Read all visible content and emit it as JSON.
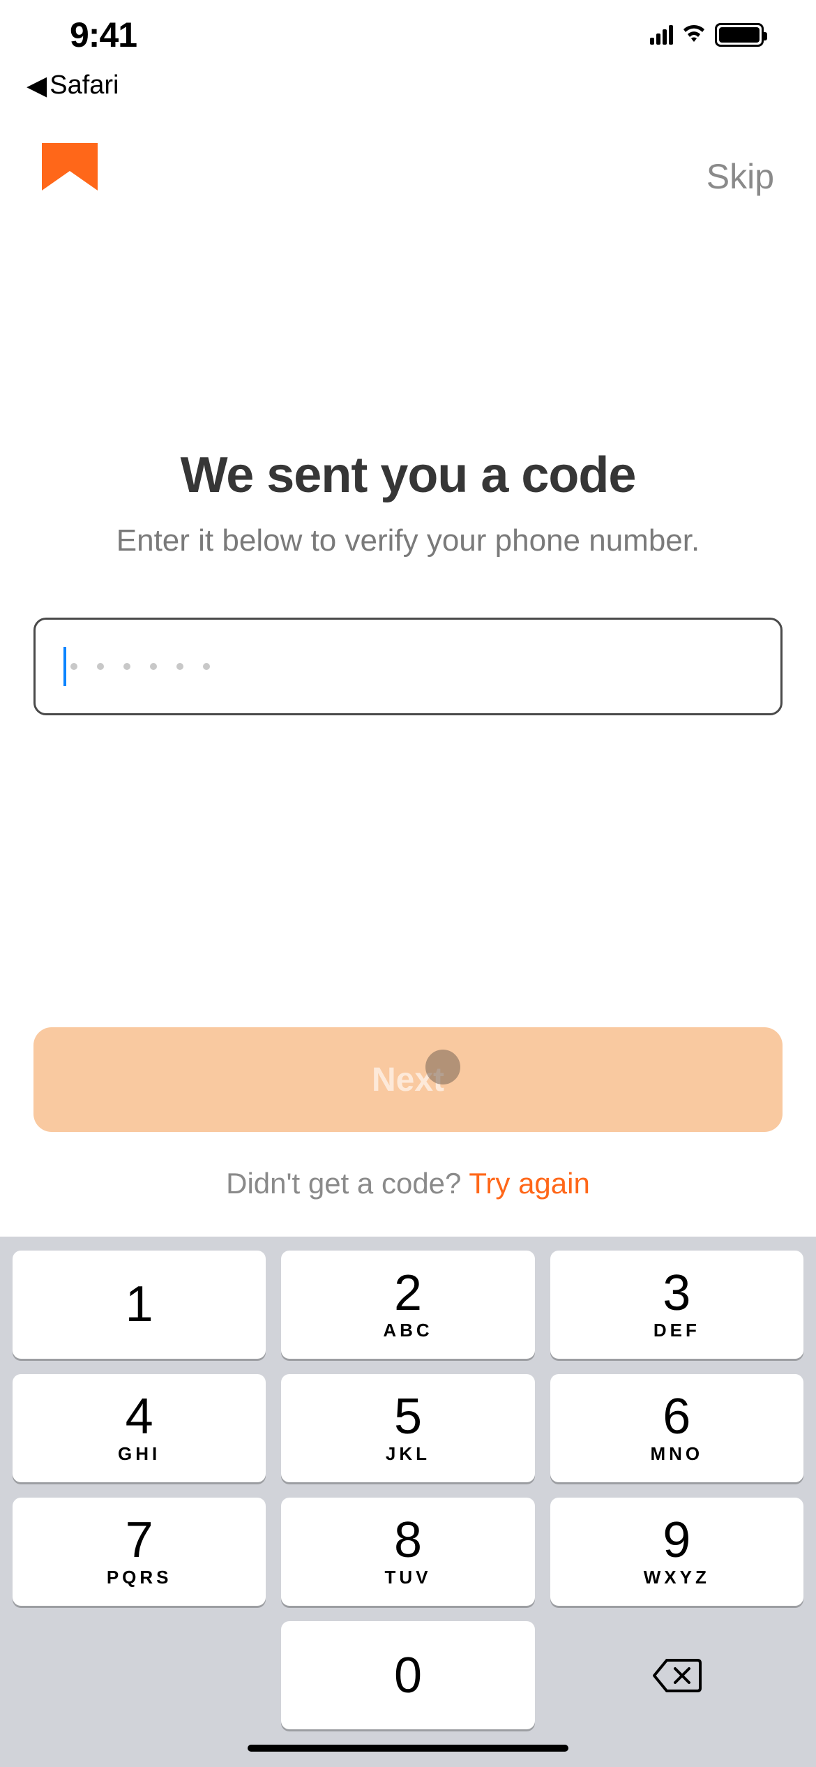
{
  "status": {
    "time": "9:41"
  },
  "back_app": {
    "label": "Safari"
  },
  "header": {
    "skip": "Skip"
  },
  "main": {
    "title": "We sent you a code",
    "subtitle": "Enter it below to verify your phone number.",
    "code_value": "",
    "next_label": "Next",
    "resend_prompt": "Didn't get a code? ",
    "resend_action": "Try again"
  },
  "keypad": {
    "keys": [
      {
        "digit": "1",
        "letters": ""
      },
      {
        "digit": "2",
        "letters": "ABC"
      },
      {
        "digit": "3",
        "letters": "DEF"
      },
      {
        "digit": "4",
        "letters": "GHI"
      },
      {
        "digit": "5",
        "letters": "JKL"
      },
      {
        "digit": "6",
        "letters": "MNO"
      },
      {
        "digit": "7",
        "letters": "PQRS"
      },
      {
        "digit": "8",
        "letters": "TUV"
      },
      {
        "digit": "9",
        "letters": "WXYZ"
      }
    ],
    "zero": {
      "digit": "0",
      "letters": ""
    }
  }
}
